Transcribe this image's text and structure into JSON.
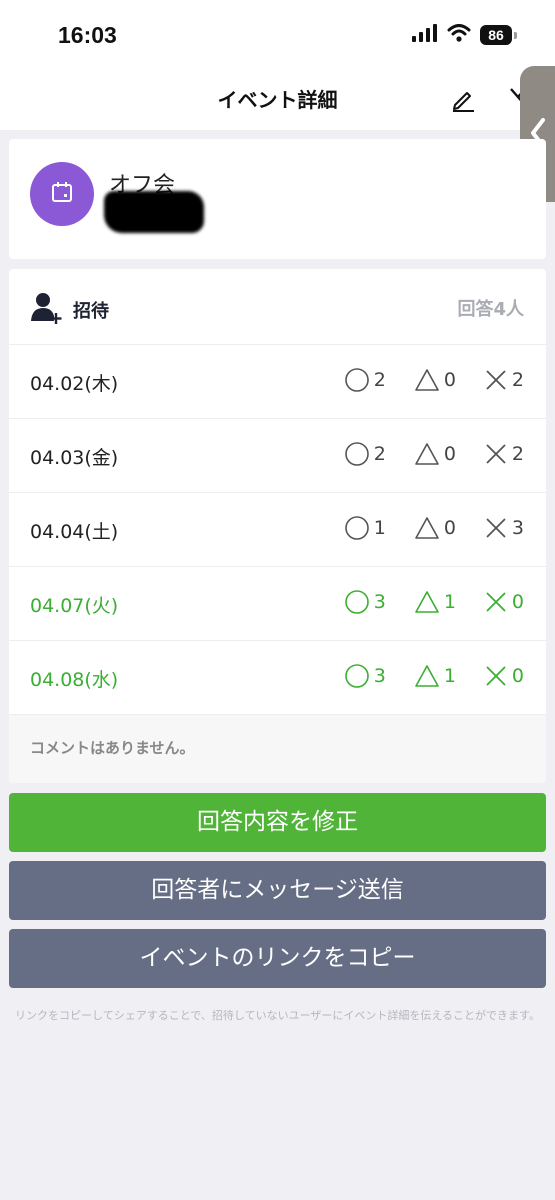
{
  "status": {
    "time": "16:03",
    "battery": "86"
  },
  "nav": {
    "title": "イベント詳細"
  },
  "event": {
    "name": "オフ会"
  },
  "invite": {
    "label": "招待",
    "responses": "回答4人"
  },
  "dates": [
    {
      "date": "04.02(木)",
      "yes": "2",
      "maybe": "0",
      "no": "2",
      "highlight": false
    },
    {
      "date": "04.03(金)",
      "yes": "2",
      "maybe": "0",
      "no": "2",
      "highlight": false
    },
    {
      "date": "04.04(土)",
      "yes": "1",
      "maybe": "0",
      "no": "3",
      "highlight": false
    },
    {
      "date": "04.07(火)",
      "yes": "3",
      "maybe": "1",
      "no": "0",
      "highlight": true
    },
    {
      "date": "04.08(水)",
      "yes": "3",
      "maybe": "1",
      "no": "0",
      "highlight": true
    }
  ],
  "comment": "コメントはありません。",
  "buttons": {
    "edit_answer": "回答内容を修正",
    "message": "回答者にメッセージ送信",
    "copy_link": "イベントのリンクをコピー"
  },
  "footnote": "リンクをコピーしてシェアすることで、招待していないユーザーにイベント詳細を伝えることができます。",
  "colors": {
    "accent_green": "#4fb437",
    "highlight_text": "#3aaf32",
    "button_gray": "#666e86",
    "avatar_purple": "#8b59d6"
  }
}
